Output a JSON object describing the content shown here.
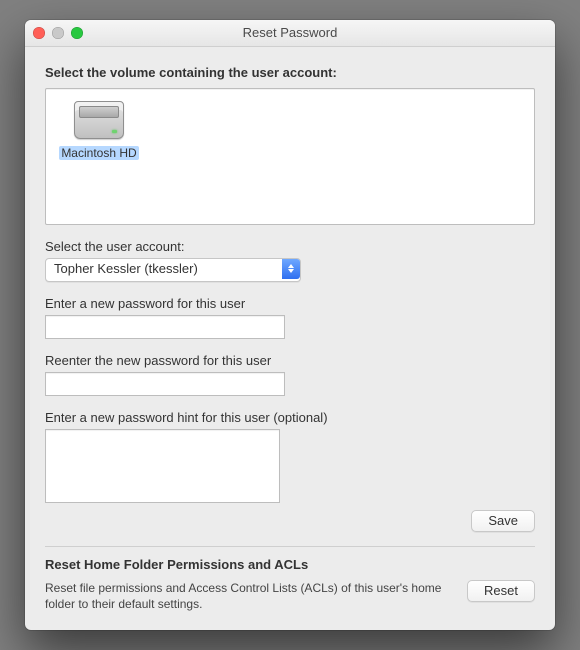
{
  "window": {
    "title": "Reset Password"
  },
  "section_volume": {
    "heading": "Select the volume containing the user account:",
    "selected_volume": "Macintosh HD"
  },
  "section_account": {
    "label": "Select the user account:",
    "selected": "Topher Kessler (tkessler)"
  },
  "password": {
    "new_label": "Enter a new password for this user",
    "new_value": "",
    "confirm_label": "Reenter the new password for this user",
    "confirm_value": "",
    "hint_label": "Enter a new password hint for this user (optional)",
    "hint_value": ""
  },
  "buttons": {
    "save": "Save",
    "reset": "Reset"
  },
  "section_acls": {
    "heading": "Reset Home Folder Permissions and ACLs",
    "description": "Reset file permissions and Access Control Lists (ACLs) of this user's home folder to their default settings."
  }
}
